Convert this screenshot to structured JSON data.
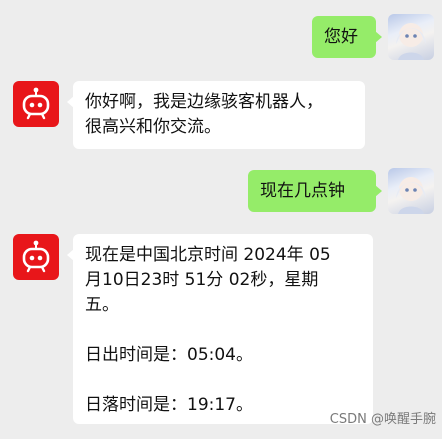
{
  "chat": {
    "messages": [
      {
        "side": "me",
        "text": "您好"
      },
      {
        "side": "other",
        "text": "你好啊，我是边缘骇客机器人，\n很高兴和你交流。"
      },
      {
        "side": "me",
        "text": "现在几点钟"
      },
      {
        "side": "other",
        "text": "现在是中国北京时间 2024年 05\n月10日23时 51分 02秒，星期\n五。\n\n日出时间是：05:04。\n\n日落时间是：19:17。"
      }
    ]
  },
  "watermark": "CSDN @唤醒手腕",
  "colors": {
    "my_bubble": "#95ec69",
    "bot_avatar": "#e8161a",
    "background": "#ededed"
  }
}
